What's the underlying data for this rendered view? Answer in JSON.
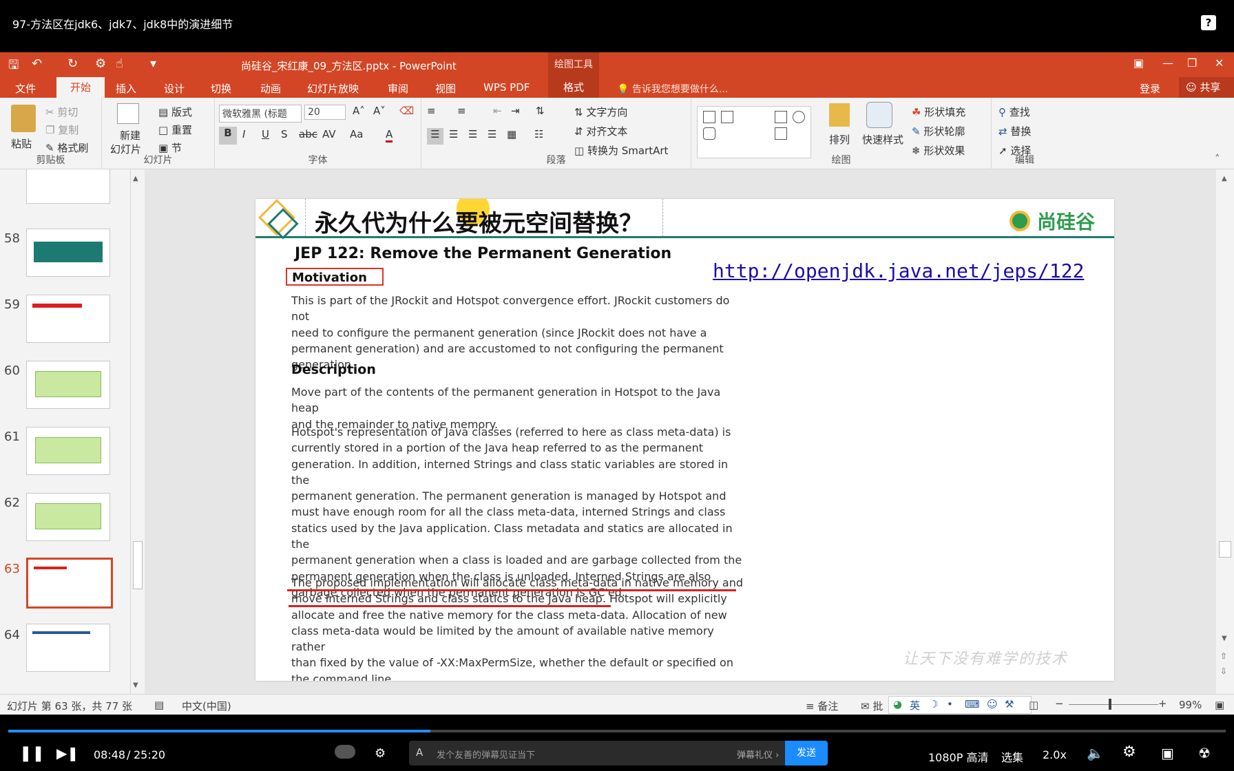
{
  "video": {
    "title": "97-方法区在jdk6、jdk7、jdk8中的演进细节",
    "help": "?",
    "current_time": "08:48",
    "separator": "/",
    "total_time": "25:20",
    "progress": 0.347,
    "danmu_placeholder": "发个友善的弹幕见证当下",
    "danmu_etiquette": "弹幕礼仪 ›",
    "send": "发送",
    "quality": "1080P 高清",
    "episodes": "选集",
    "speed": "2.0x"
  },
  "ppt": {
    "doc_title": "尚硅谷_宋红康_09_方法区.pptx - PowerPoint",
    "drawing_tools": "绘图工具",
    "tabs": [
      "文件",
      "开始",
      "插入",
      "设计",
      "切换",
      "动画",
      "幻灯片放映",
      "审阅",
      "视图",
      "WPS PDF",
      "格式"
    ],
    "tell_me": "告诉我您想要做什么...",
    "login": "登录",
    "share": "共享"
  },
  "ribbon": {
    "clipboard": {
      "paste": "粘贴",
      "cut": "剪切",
      "copy": "复制",
      "painter": "格式刷",
      "label": "剪贴板"
    },
    "slides": {
      "new_slide": "新建",
      "new_slide2": "幻灯片",
      "layout": "版式",
      "reset": "重置",
      "section": "节",
      "label": "幻灯片"
    },
    "font": {
      "name": "微软雅黑 (标题",
      "size": "20",
      "label": "字体"
    },
    "paragraph": {
      "text_direction": "文字方向",
      "align_text": "对齐文本",
      "smartart": "转换为 SmartArt",
      "label": "段落"
    },
    "drawing": {
      "arrange": "排列",
      "quick_styles": "快速样式",
      "fill": "形状填充",
      "outline": "形状轮廓",
      "effects": "形状效果",
      "label": "绘图"
    },
    "editing": {
      "find": "查找",
      "replace": "替换",
      "select": "选择",
      "label": "编辑"
    }
  },
  "thumbnails": [
    {
      "num": "58"
    },
    {
      "num": "59"
    },
    {
      "num": "60"
    },
    {
      "num": "61"
    },
    {
      "num": "62"
    },
    {
      "num": "63"
    },
    {
      "num": "64"
    }
  ],
  "slide": {
    "title": "永久代为什么要被元空间替换？",
    "logo": "尚硅谷",
    "jep": "JEP 122: Remove the Permanent Generation",
    "url": "http://openjdk.java.net/jeps/122",
    "motivation": "Motivation",
    "motivation_lines": [
      "This is part of the JRockit and Hotspot convergence effort. JRockit customers do not",
      "need to configure the permanent generation (since JRockit does not have a",
      "permanent generation) and are accustomed to not configuring the permanent",
      "generation."
    ],
    "description": "Description",
    "desc1_lines": [
      "Move part of the contents of the permanent generation in Hotspot to the Java heap",
      "and the remainder to native memory."
    ],
    "desc2_lines": [
      "Hotspot's representation of Java classes (referred to here as class meta-data) is",
      "currently stored in a portion of the Java heap referred to as the permanent",
      "generation. In addition, interned Strings and class static variables are stored in the",
      "permanent generation. The permanent generation is managed by Hotspot and",
      "must have enough room for all the class meta-data, interned Strings and class",
      "statics used by the Java application. Class metadata and statics are allocated in the",
      "permanent generation when a class is loaded and are garbage collected from the",
      "permanent generation when the class is unloaded. Interned Strings are also",
      "garbage collected when the permanent generation is GC'ed."
    ],
    "desc3_lines": [
      "The proposed implementation will allocate class meta-data in native memory and",
      "move interned Strings and class statics to the Java heap. Hotspot will explicitly",
      "allocate and free the native memory for the class meta-data. Allocation of new",
      "class meta-data would be limited by the amount of available native memory rather",
      "than fixed by the value of -XX:MaxPermSize, whether the default or specified on",
      "the command line."
    ],
    "watermark": "让天下没有难学的技术"
  },
  "status": {
    "slide_info": "幻灯片 第 63 张，共 77 张",
    "language": "中文(中国)",
    "notes": "备注",
    "comments": "批",
    "ime": "英",
    "zoom": "99%"
  },
  "colors": {
    "ppt_orange": "#d24625",
    "slide_teal": "#1d7a72",
    "underline_red": "#d9201e",
    "link_blue": "#1a0dab"
  }
}
